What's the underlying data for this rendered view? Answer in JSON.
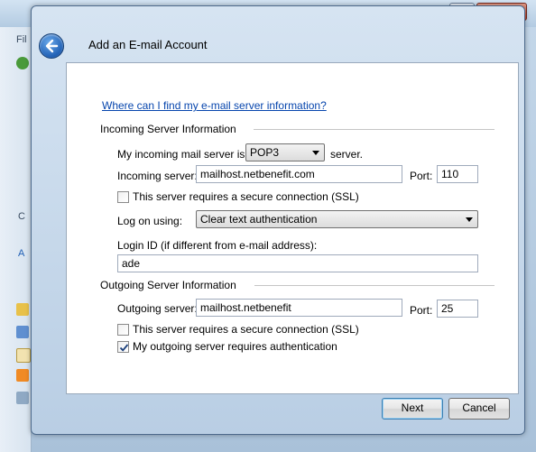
{
  "background": {
    "menu_fragment": "Fil",
    "letters": [
      "C",
      "A"
    ]
  },
  "dialog": {
    "title": "Add an E-mail Account",
    "help_link": "Where can I find my e-mail server information?",
    "incoming": {
      "group_label": "Incoming Server Information",
      "server_type_prefix": "My incoming mail server is a",
      "server_type_value": "POP3",
      "server_type_suffix": "server.",
      "server_label": "Incoming server:",
      "server_value": "mailhost.netbenefit.com",
      "port_label": "Port:",
      "port_value": "110",
      "ssl_label": "This server requires a secure connection (SSL)",
      "ssl_checked": false,
      "logon_label": "Log on using:",
      "logon_value": "Clear text authentication",
      "login_id_label": "Login ID (if different from e-mail address):",
      "login_id_value": "ade"
    },
    "outgoing": {
      "group_label": "Outgoing Server Information",
      "server_label": "Outgoing server:",
      "server_value": "mailhost.netbenefit",
      "port_label": "Port:",
      "port_value": "25",
      "ssl_label": "This server requires a secure connection (SSL)",
      "ssl_checked": false,
      "auth_label": "My outgoing server requires authentication",
      "auth_checked": true
    },
    "buttons": {
      "next": "Next",
      "cancel": "Cancel"
    }
  }
}
